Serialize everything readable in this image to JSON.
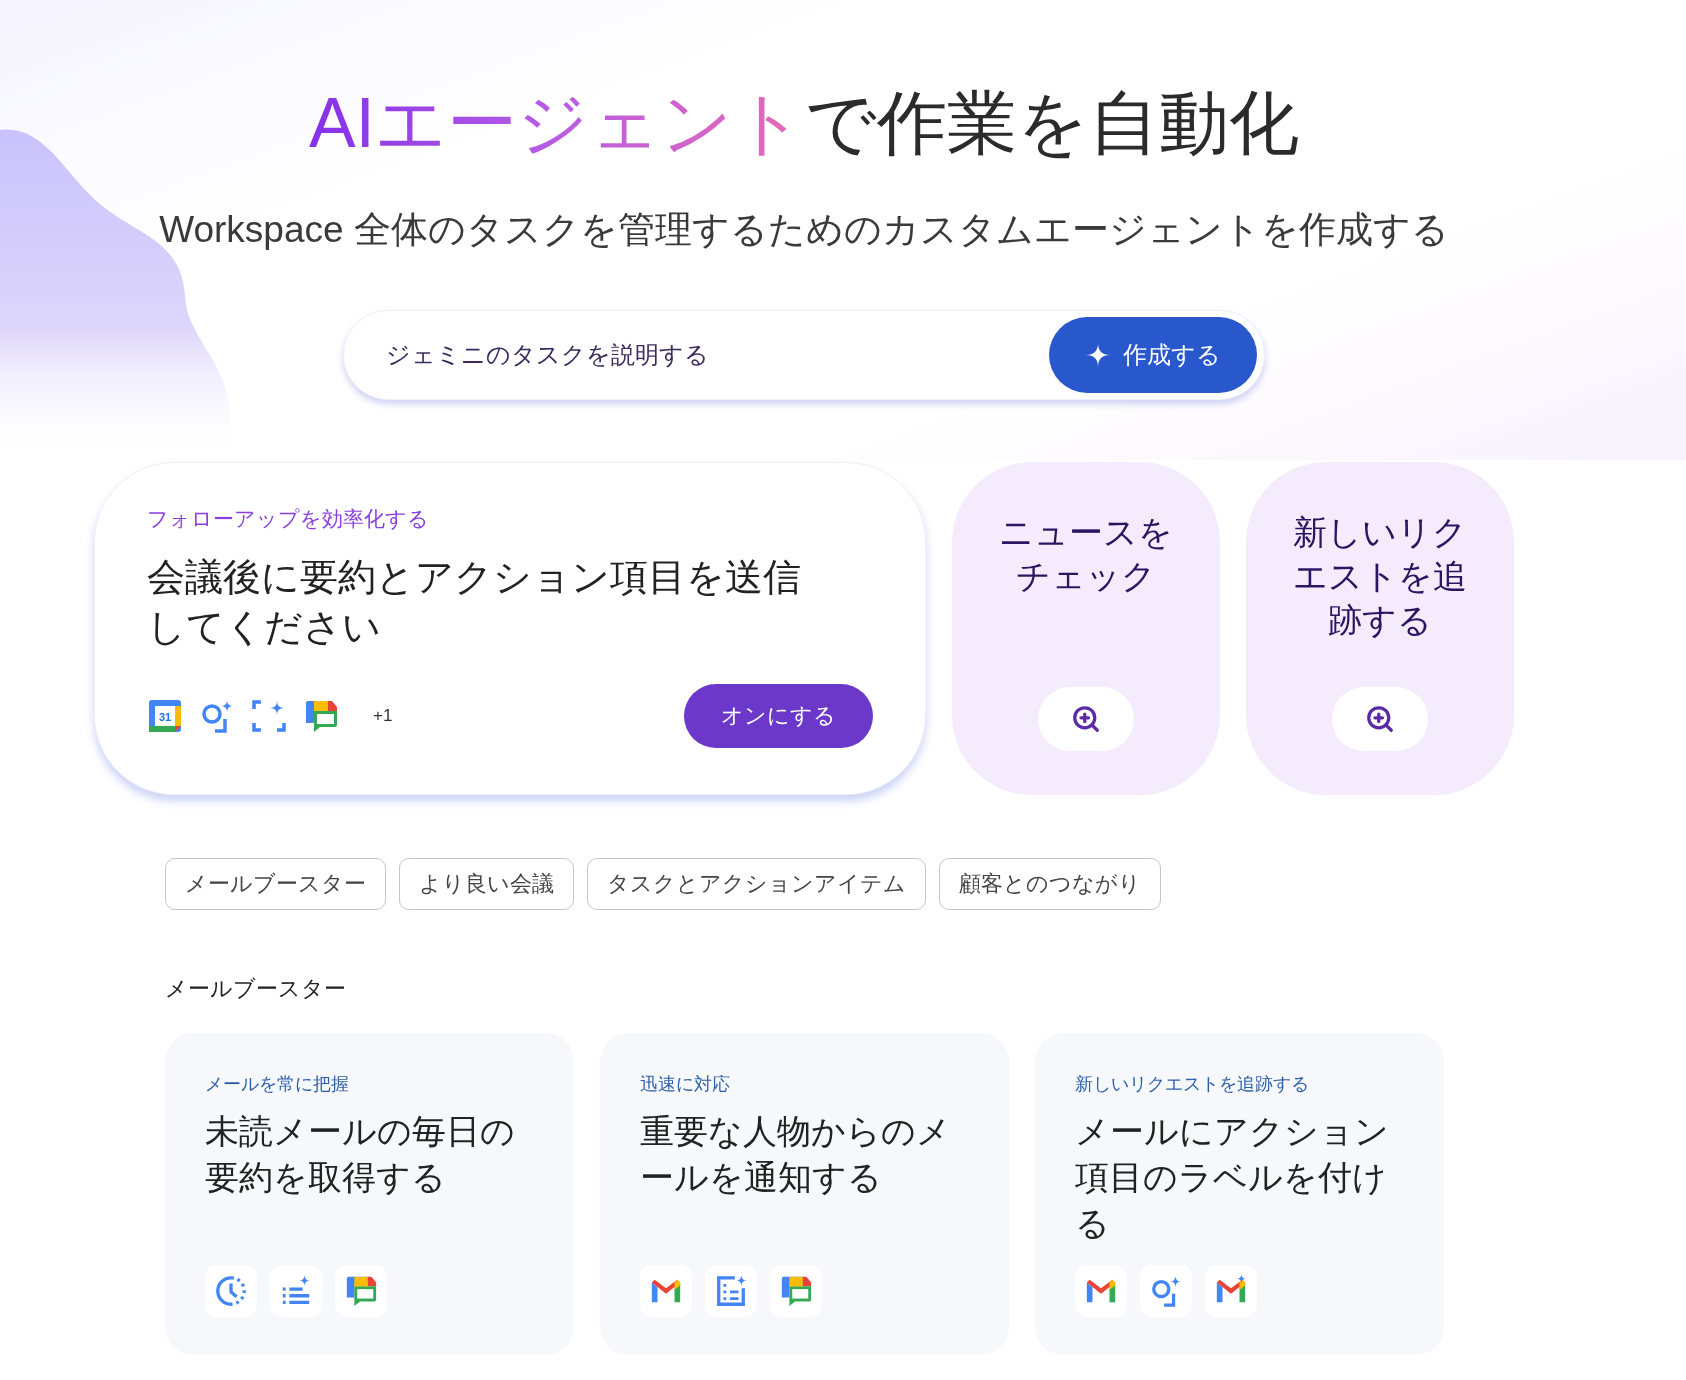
{
  "hero": {
    "title_highlight": "AIエージェント",
    "title_rest": "で作業を自動化",
    "subtitle": "Workspace 全体のタスクを管理するためのカスタムエージェントを作成する"
  },
  "prompt": {
    "placeholder": "ジェミニのタスクを説明する",
    "button": "作成する"
  },
  "featured": {
    "eyebrow": "フォローアップを効率化する",
    "title": "会議後に要約とアクション項目を送信してください",
    "apps": [
      {
        "kind": "calendar",
        "label": "31"
      },
      {
        "kind": "lens"
      },
      {
        "kind": "scan"
      },
      {
        "kind": "chat"
      }
    ],
    "more": "+1",
    "button": "オンにする"
  },
  "suggestions": [
    {
      "title": "ニュースをチェック"
    },
    {
      "title": "新しいリクエストを追跡する"
    }
  ],
  "filters": [
    {
      "label": "メールブースター"
    },
    {
      "label": "より良い会議"
    },
    {
      "label": "タスクとアクションアイテム"
    },
    {
      "label": "顧客とのつながり"
    }
  ],
  "section": {
    "title": "メールブースター",
    "cards": [
      {
        "eyebrow": "メールを常に把握",
        "title": "未読メールの毎日の要約を取得する",
        "apps": [
          {
            "kind": "clock"
          },
          {
            "kind": "list"
          },
          {
            "kind": "chat"
          }
        ]
      },
      {
        "eyebrow": "迅速に対応",
        "title": "重要な人物からのメールを通知する",
        "apps": [
          {
            "kind": "mail"
          },
          {
            "kind": "doc"
          },
          {
            "kind": "chat"
          }
        ]
      },
      {
        "eyebrow": "新しいリクエストを追跡する",
        "title": "メールにアクション項目のラベルを付ける",
        "apps": [
          {
            "kind": "mail"
          },
          {
            "kind": "lens"
          },
          {
            "kind": "mail_spark"
          }
        ]
      }
    ]
  }
}
